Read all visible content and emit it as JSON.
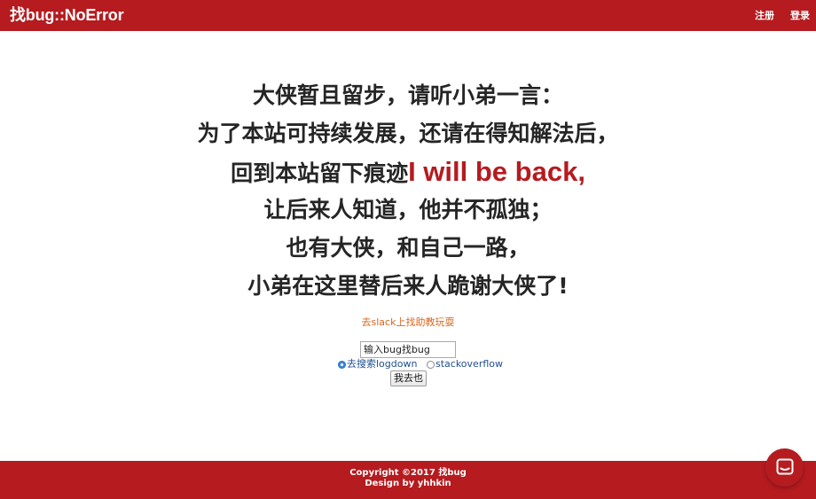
{
  "header": {
    "brand": "找bug::NoError",
    "nav": {
      "register": "注册",
      "login": "登录"
    }
  },
  "message": {
    "line1": "大侠暂且留步，请听小弟一言：",
    "line2": "为了本站可持续发展，还请在得知解法后，",
    "line3_prefix": "回到本站留下痕迹",
    "line3_highlight": "I will be back,",
    "line4": "让后来人知道，他并不孤独；",
    "line5": "也有大侠，和自己一路，",
    "line6": "小弟在这里替后来人跪谢大侠了!"
  },
  "slack_link": "去slack上找助教玩耍",
  "search": {
    "placeholder": "输入bug找bug",
    "options": [
      {
        "label": "去搜索logdown",
        "checked": true
      },
      {
        "label": "stackoverflow",
        "checked": false
      }
    ],
    "submit_label": "我去也"
  },
  "footer": {
    "copyright": "Copyright ©2017 找bug",
    "credit": "Design by yhhkin"
  },
  "chat": {
    "icon": "chat-bubble-icon"
  },
  "colors": {
    "brand_red": "#b51b1f",
    "link_orange": "#d9661e",
    "radio_label_blue": "#1f4e91"
  }
}
